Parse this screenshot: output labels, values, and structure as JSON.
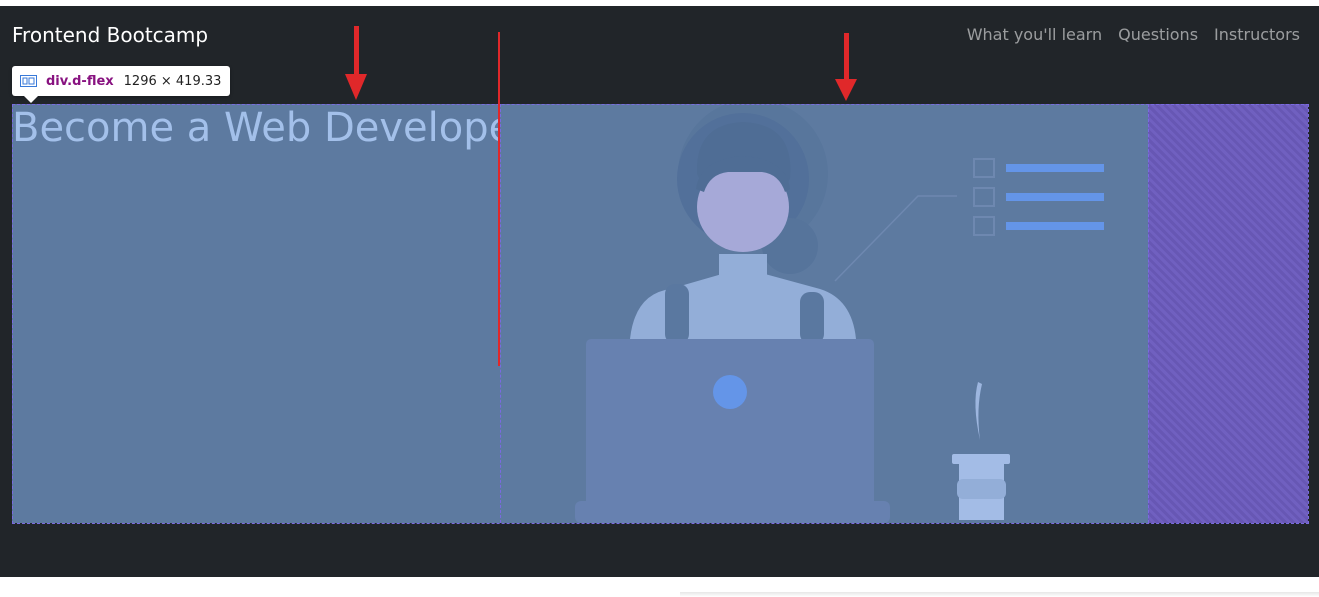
{
  "navbar": {
    "brand": "Frontend Bootcamp",
    "links": [
      "What you'll learn",
      "Questions",
      "Instructors"
    ]
  },
  "hero": {
    "title": "Become a Web Developer"
  },
  "devtools_tooltip": {
    "selector": "div.d-flex",
    "size": "1296 × 419.33",
    "icon": "flex-container-icon"
  },
  "annotations": {
    "arrow_icon": "red-arrow-down-icon",
    "line": "red-vertical-line",
    "color": "#e0282a"
  },
  "colors": {
    "page_bg": "#212529",
    "overlay_content": "#5d7aa0",
    "overlay_margin": "#6757b4",
    "tooltip_selector": "#881280"
  }
}
